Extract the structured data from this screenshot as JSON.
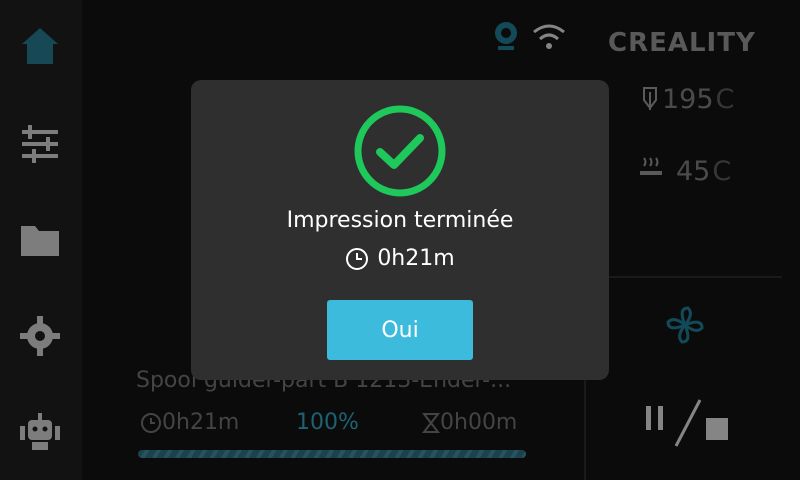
{
  "brand": "CREALITY",
  "status": {
    "nozzle_temp": "195",
    "bed_temp": "45",
    "temp_unit": "C"
  },
  "job": {
    "file_name": "Spool guider-part B 1213-Ender-...",
    "elapsed": "0h21m",
    "progress": "100%",
    "progress_value": 1.0,
    "remaining": "0h00m"
  },
  "dialog": {
    "title": "Impression terminée",
    "duration": "0h21m",
    "confirm_label": "Oui"
  },
  "colors": {
    "accent": "#3dbbdc",
    "success": "#1ec85a",
    "dialog_bg": "#2f2f2f"
  },
  "sidebar_icons": [
    "home-icon",
    "sliders-icon",
    "folder-icon",
    "gear-icon",
    "robot-icon"
  ]
}
